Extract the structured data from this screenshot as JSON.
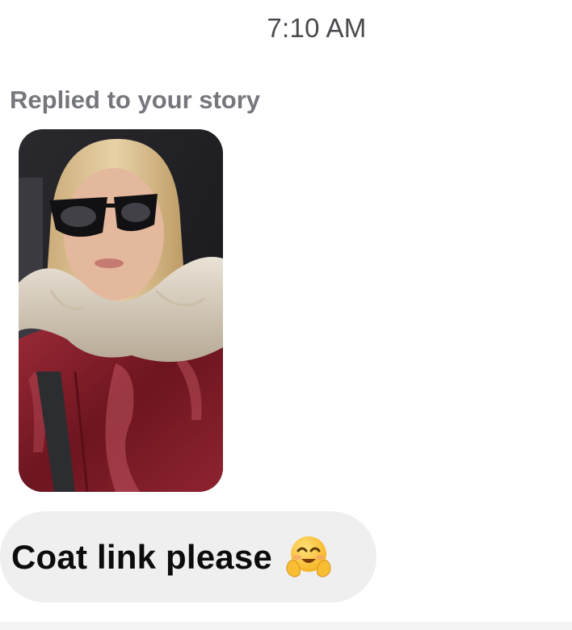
{
  "header": {
    "timestamp": "7:10 AM"
  },
  "story_reply": {
    "label": "Replied to your story",
    "thumbnail": "story-selfie-red-puffer-coat"
  },
  "message": {
    "text": "Coat link please",
    "emoji": "hugging-face-icon"
  },
  "colors": {
    "bubble": "#efeff0",
    "label": "#75777c",
    "timestamp": "#4a4a4e",
    "coat": "#7a1e2a"
  }
}
